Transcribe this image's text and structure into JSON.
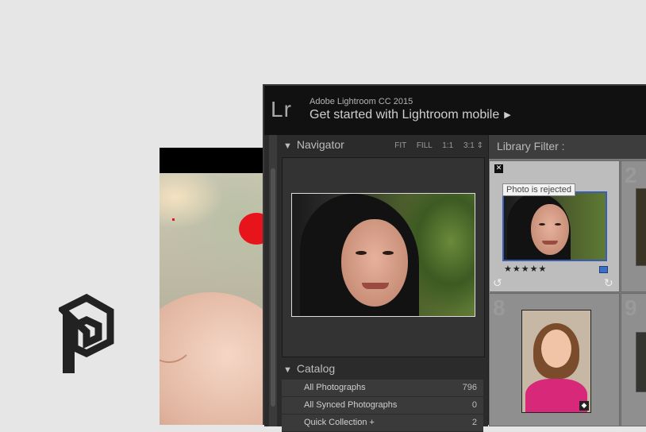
{
  "logo": {
    "name": "brand-logo-icon"
  },
  "lightroom": {
    "logo_text": "Lr",
    "product": "Adobe Lightroom CC 2015",
    "mobile_prompt": "Get started with Lightroom mobile",
    "mobile_arrow": "▶"
  },
  "navigator": {
    "title": "Navigator",
    "options": [
      "FIT",
      "FILL",
      "1:1",
      "3:1 ⇕"
    ]
  },
  "catalog": {
    "title": "Catalog",
    "rows": [
      {
        "name": "All Photographs",
        "count": "796"
      },
      {
        "name": "All Synced Photographs",
        "count": "0"
      },
      {
        "name": "Quick Collection +",
        "count": "2"
      }
    ]
  },
  "library_filter": {
    "title": "Library Filter :"
  },
  "grid": {
    "cell1": {
      "number": "",
      "tooltip": "Photo is rejected",
      "reject_mark": "✕",
      "stars": "★★★★★"
    },
    "cell2": {
      "number": "2"
    },
    "cell3": {
      "number": "8"
    },
    "cell4": {
      "number": "9"
    }
  },
  "colors": {
    "selection_border": "#3b5eb5",
    "background": "#e6e6e6"
  }
}
